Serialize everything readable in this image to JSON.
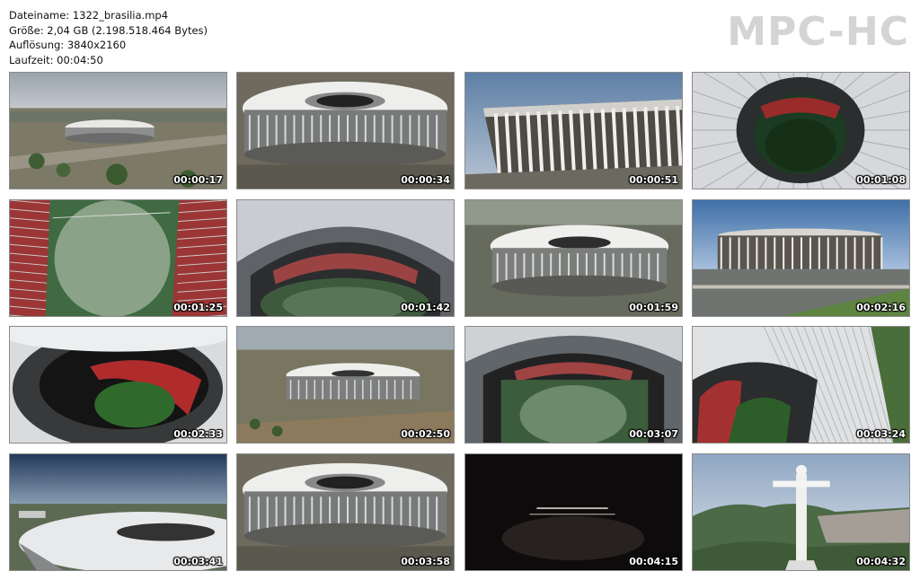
{
  "file_info": {
    "filename": "Dateiname: 1322_brasilia.mp4",
    "size": "Größe: 2,04 GB (2.198.518.464 Bytes)",
    "resolution": "Auflösung: 3840x2160",
    "duration": "Laufzeit: 00:04:50"
  },
  "logo_text": "MPC-HC",
  "thumbnails": [
    {
      "time": "00:00:17",
      "scene": "aerial-wide-city"
    },
    {
      "time": "00:00:34",
      "scene": "stadium-oblique-close"
    },
    {
      "time": "00:00:51",
      "scene": "stadium-columns-facade"
    },
    {
      "time": "00:01:08",
      "scene": "roof-top-down"
    },
    {
      "time": "00:01:25",
      "scene": "pitch-top-down"
    },
    {
      "time": "00:01:42",
      "scene": "roof-opening-view"
    },
    {
      "time": "00:01:59",
      "scene": "stadium-oblique-mid"
    },
    {
      "time": "00:02:16",
      "scene": "stadium-ground-level"
    },
    {
      "time": "00:02:33",
      "scene": "bowl-red-seats"
    },
    {
      "time": "00:02:50",
      "scene": "stadium-aerial-wide"
    },
    {
      "time": "00:03:07",
      "scene": "roof-opening-pitch"
    },
    {
      "time": "00:03:24",
      "scene": "roof-edge-seats"
    },
    {
      "time": "00:03:41",
      "scene": "roof-horizon"
    },
    {
      "time": "00:03:58",
      "scene": "stadium-oblique-close"
    },
    {
      "time": "00:04:15",
      "scene": "dark-credits"
    },
    {
      "time": "00:04:32",
      "scene": "statue-city"
    }
  ]
}
